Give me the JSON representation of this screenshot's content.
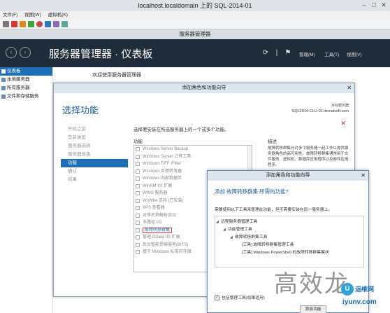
{
  "vm_window": {
    "title": "localhost.localdomain 上的 SQL-2014-01",
    "menu": [
      "文件(F)",
      "视图(W)",
      "虚拟机(K)"
    ],
    "toolbar_icons": [
      "ctrl-alt-del-icon",
      "stop-icon",
      "pause-icon",
      "start-icon",
      "reset-icon",
      "checkpoint-icon",
      "revert-icon",
      "enhanced-session-icon"
    ]
  },
  "server_manager": {
    "window_title": "服务器管理器",
    "breadcrumb": "服务器管理器 · 仪表板",
    "menus": {
      "manage": "管理(M)",
      "tools": "工具(T)",
      "view": "视图(V)"
    },
    "sidebar": [
      {
        "label": "仪表板",
        "active": true
      },
      {
        "label": "本地服务器",
        "active": false
      },
      {
        "label": "所有服务器",
        "active": false
      },
      {
        "label": "文件和存储服务",
        "active": false
      }
    ],
    "welcome": "欢迎使用服务器管理器"
  },
  "wizard": {
    "title": "添加角色和功能向导",
    "heading": "选择功能",
    "target_label": "目标服务器",
    "target_server": "SQL2014-CLU-01.iternalsoft.com",
    "steps": [
      {
        "label": "开始之前",
        "active": false
      },
      {
        "label": "安装类型",
        "active": false
      },
      {
        "label": "服务器选择",
        "active": false
      },
      {
        "label": "服务器角色",
        "active": false
      },
      {
        "label": "功能",
        "active": true
      },
      {
        "label": "确认",
        "active": false
      },
      {
        "label": "结果",
        "active": false
      }
    ],
    "instruction": "选择要安装在所选服务器上的一个或多个功能。",
    "features_header": "功能",
    "features": [
      {
        "label": "Windows Server Backup",
        "highlight": false
      },
      {
        "label": "Windows Server 迁移工具",
        "highlight": false
      },
      {
        "label": "Windows TIFF IFilter",
        "highlight": false
      },
      {
        "label": "Windows 反馈转发器",
        "highlight": false
      },
      {
        "label": "Windows 内部数据库",
        "highlight": false
      },
      {
        "label": "WinRM IIS 扩展",
        "highlight": false
      },
      {
        "label": "WINS 服务器",
        "highlight": false
      },
      {
        "label": "WoW64 支持 (已安装)",
        "highlight": false
      },
      {
        "label": "XPS 查看器",
        "highlight": false
      },
      {
        "label": "对等名称解析协议",
        "highlight": false
      },
      {
        "label": "多路径 I/O",
        "highlight": false
      },
      {
        "label": "故障转移群集",
        "highlight": true
      },
      {
        "label": "管理 OData IIS 扩展",
        "highlight": false
      },
      {
        "label": "后台智能传输服务(BITS)",
        "highlight": false
      },
      {
        "label": "基于 Windows 标准的存储",
        "highlight": false
      }
    ],
    "description_header": "描述",
    "description": "故障转移群集允许多个服务器一起工作以提供服务器角色的高可用性。故障转移群集通常用于文件服务、虚拟机、数据库应用程序以及邮件应用程序。"
  },
  "popup": {
    "title": "添加角色和功能向导",
    "question": "添加 故障转移群集 所需的功能?",
    "description": "需要使用以下工具来管理此功能，但不需要安装在同一服务器上。",
    "tree": [
      {
        "label": "远程服务器管理工具",
        "level": 0
      },
      {
        "label": "功能管理工具",
        "level": 1
      },
      {
        "label": "故障转移群集工具",
        "level": 2
      },
      {
        "label": "[工具] 故障转移群集管理工具",
        "level": 3
      },
      {
        "label": "[工具] Windows PowerShell 的故障转移群集模块",
        "level": 3
      }
    ],
    "include_tools_label": "包括管理工具(如果适用)",
    "include_tools_checked": true,
    "add_button": "添加功能"
  },
  "watermark": {
    "text": "高效龙",
    "logo_cn": "运维网",
    "logo_url": "iyunv.com"
  }
}
